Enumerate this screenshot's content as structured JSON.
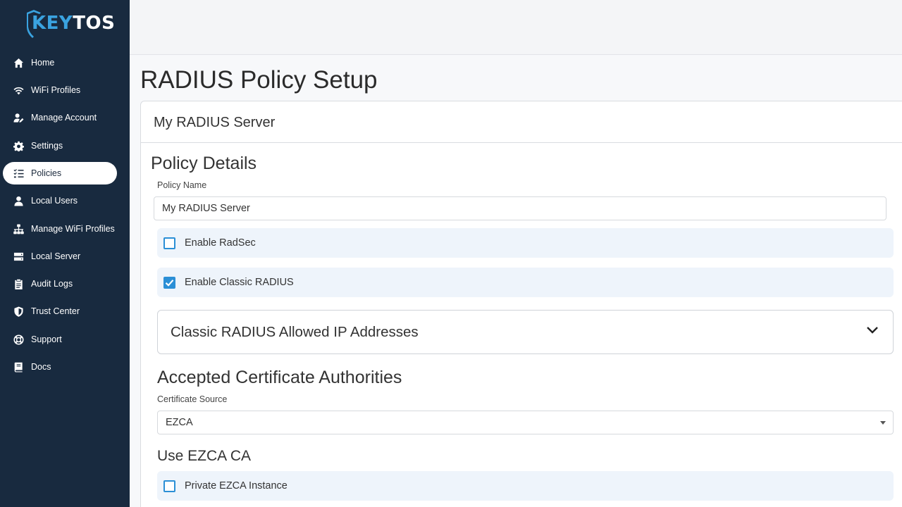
{
  "brand": {
    "key": "KEY",
    "tos": "TOS",
    "accent": "#3aa3e0",
    "sidebar_bg": "#182a3f"
  },
  "sidebar": {
    "items": [
      {
        "label": "Home",
        "icon": "home-icon",
        "active": false
      },
      {
        "label": "WiFi Profiles",
        "icon": "wifi-icon",
        "active": false
      },
      {
        "label": "Manage Account",
        "icon": "user-edit-icon",
        "active": false
      },
      {
        "label": "Settings",
        "icon": "gear-icon",
        "active": false
      },
      {
        "label": "Policies",
        "icon": "list-check-icon",
        "active": true
      },
      {
        "label": "Local Users",
        "icon": "user-icon",
        "active": false
      },
      {
        "label": "Manage WiFi Profiles",
        "icon": "network-icon",
        "active": false
      },
      {
        "label": "Local Server",
        "icon": "server-icon",
        "active": false
      },
      {
        "label": "Audit Logs",
        "icon": "clipboard-icon",
        "active": false
      },
      {
        "label": "Trust Center",
        "icon": "shield-icon",
        "active": false
      },
      {
        "label": "Support",
        "icon": "lifebuoy-icon",
        "active": false
      },
      {
        "label": "Docs",
        "icon": "book-icon",
        "active": false
      }
    ]
  },
  "page": {
    "title": "RADIUS Policy Setup"
  },
  "card": {
    "title": "My RADIUS Server",
    "policy_details": {
      "heading": "Policy Details",
      "name_label": "Policy Name",
      "name_value": "My RADIUS Server"
    },
    "enable_radsec": {
      "label": "Enable RadSec",
      "checked": false
    },
    "enable_classic": {
      "label": "Enable Classic RADIUS",
      "checked": true
    },
    "allowed_ips": {
      "title": "Classic RADIUS Allowed IP Addresses"
    },
    "cas": {
      "heading": "Accepted Certificate Authorities",
      "source_label": "Certificate Source",
      "source_value": "EZCA"
    },
    "ezca": {
      "heading": "Use EZCA CA",
      "private_label": "Private EZCA Instance",
      "private_checked": false
    }
  }
}
